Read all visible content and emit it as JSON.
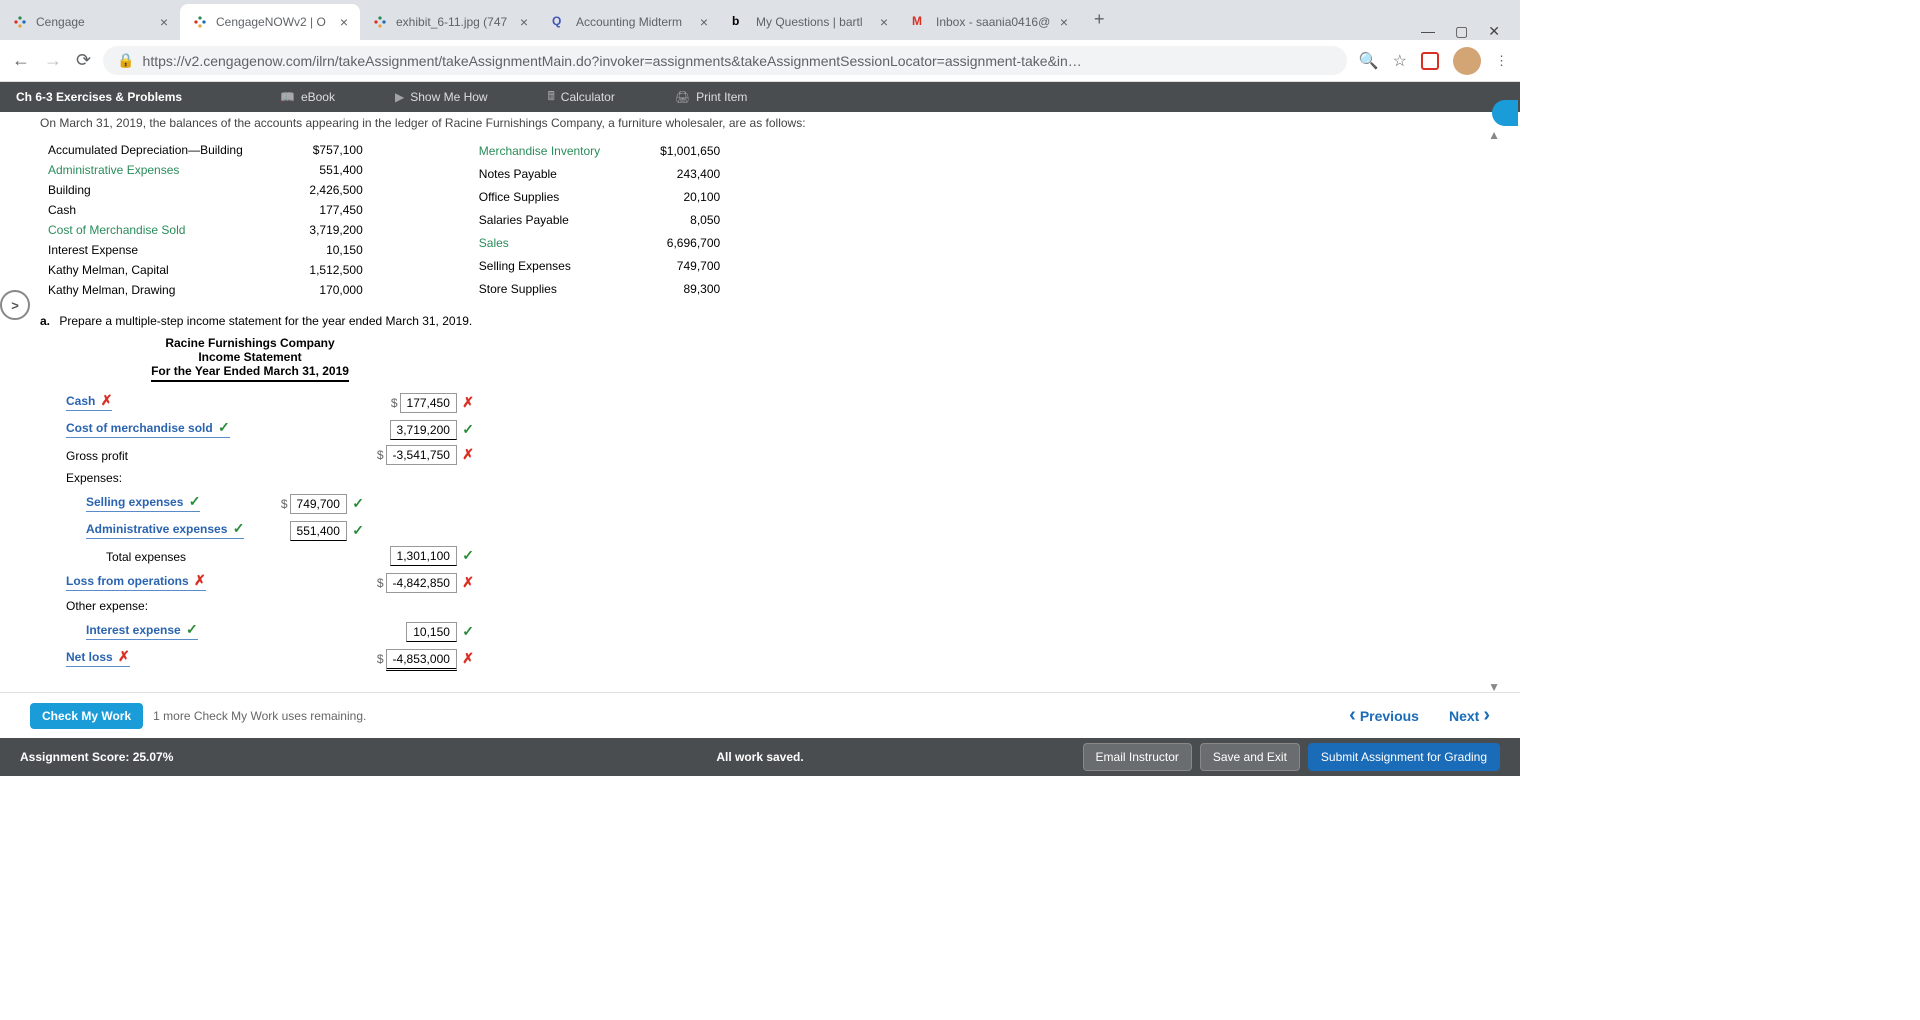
{
  "browser": {
    "tabs": [
      {
        "title": "Cengage",
        "favicon": "cengage"
      },
      {
        "title": "CengageNOWv2 | O",
        "favicon": "cengage",
        "active": true
      },
      {
        "title": "exhibit_6-11.jpg (747",
        "favicon": "cengage"
      },
      {
        "title": "Accounting Midterm",
        "favicon": "Q"
      },
      {
        "title": "My Questions | bartl",
        "favicon": "b"
      },
      {
        "title": "Inbox - saania0416@",
        "favicon": "M"
      }
    ],
    "url": "https://v2.cengagenow.com/ilrn/takeAssignment/takeAssignmentMain.do?invoker=assignments&takeAssignmentSessionLocator=assignment-take&in…"
  },
  "header": {
    "title": "Ch 6-3 Exercises & Problems",
    "tools": [
      "eBook",
      "Show Me How",
      "Calculator",
      "Print Item"
    ]
  },
  "intro": "On March 31, 2019, the balances of the accounts appearing in the ledger of Racine Furnishings Company, a furniture wholesaler, are as follows:",
  "ledger_left": [
    {
      "label": "Accumulated Depreciation—Building",
      "val": "$757,100"
    },
    {
      "label": "Administrative Expenses",
      "val": "551,400",
      "green": true
    },
    {
      "label": "Building",
      "val": "2,426,500"
    },
    {
      "label": "Cash",
      "val": "177,450"
    },
    {
      "label": "Cost of Merchandise Sold",
      "val": "3,719,200",
      "green": true
    },
    {
      "label": "Interest Expense",
      "val": "10,150"
    },
    {
      "label": "Kathy Melman, Capital",
      "val": "1,512,500"
    },
    {
      "label": "Kathy Melman, Drawing",
      "val": "170,000"
    }
  ],
  "ledger_right": [
    {
      "label": "Merchandise Inventory",
      "val": "$1,001,650",
      "green": true
    },
    {
      "label": "Notes Payable",
      "val": "243,400"
    },
    {
      "label": "Office Supplies",
      "val": "20,100"
    },
    {
      "label": "Salaries Payable",
      "val": "8,050"
    },
    {
      "label": "Sales",
      "val": "6,696,700",
      "green": true
    },
    {
      "label": "Selling Expenses",
      "val": "749,700"
    },
    {
      "label": "Store Supplies",
      "val": "89,300"
    }
  ],
  "instruction": {
    "letter": "a.",
    "text": "Prepare a multiple-step income statement for the year ended March 31, 2019."
  },
  "stmt": {
    "h1": "Racine Furnishings Company",
    "h2": "Income Statement",
    "h3": "For the Year Ended March 31, 2019",
    "rows": [
      {
        "label": "Cash",
        "labelMark": "bad",
        "dollar": true,
        "col": 3,
        "val": "177,450",
        "mark": "bad"
      },
      {
        "label": "Cost of merchandise sold",
        "labelMark": "ok",
        "col": 3,
        "val": "3,719,200",
        "mark": "ok",
        "ul": 1
      },
      {
        "plain": "Gross profit",
        "dollar": true,
        "col": 3,
        "val": "-3,541,750",
        "mark": "bad"
      },
      {
        "plain": "Expenses:"
      },
      {
        "indent": 1,
        "label": "Selling expenses",
        "labelMark": "ok",
        "dollar": true,
        "col": 2,
        "val": "749,700",
        "mark": "ok"
      },
      {
        "indent": 1,
        "label": "Administrative expenses",
        "labelMark": "ok",
        "col": 2,
        "val": "551,400",
        "mark": "ok",
        "ul": 1
      },
      {
        "indent": 2,
        "plain": "Total expenses",
        "col": 3,
        "val": "1,301,100",
        "mark": "ok",
        "ul": 1
      },
      {
        "label": "Loss from operations",
        "labelMark": "bad",
        "dollar": true,
        "col": 3,
        "val": "-4,842,850",
        "mark": "bad"
      },
      {
        "plain": "Other expense:"
      },
      {
        "indent": 1,
        "label": "Interest expense",
        "labelMark": "ok",
        "col": 3,
        "val": "10,150",
        "mark": "ok",
        "ul": 1
      },
      {
        "label": "Net loss",
        "labelMark": "bad",
        "dollar": true,
        "col": 3,
        "val": "-4,853,000",
        "mark": "bad",
        "ul": 2
      }
    ]
  },
  "cmw": {
    "btn": "Check My Work",
    "text": "1 more Check My Work uses remaining.",
    "prev": "Previous",
    "next": "Next"
  },
  "footer": {
    "score": "Assignment Score: 25.07%",
    "saved": "All work saved.",
    "b1": "Email Instructor",
    "b2": "Save and Exit",
    "b3": "Submit Assignment for Grading"
  }
}
